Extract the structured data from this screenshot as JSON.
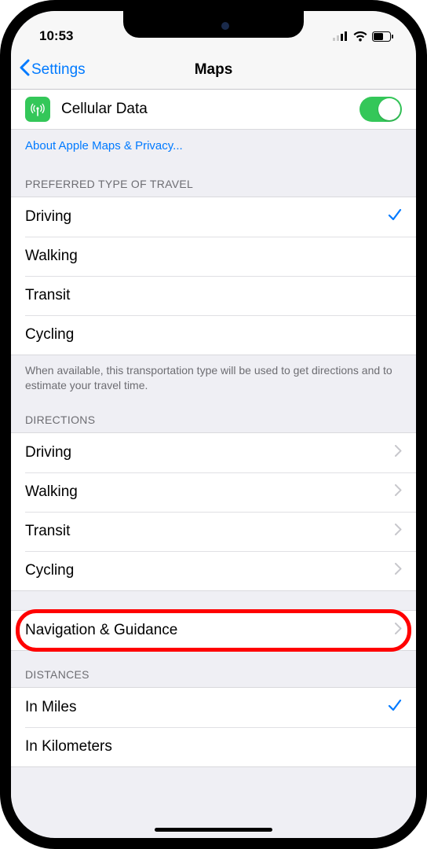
{
  "status": {
    "time": "10:53"
  },
  "nav": {
    "back": "Settings",
    "title": "Maps"
  },
  "cellular": {
    "label": "Cellular Data",
    "on": true
  },
  "privacy_link": "About Apple Maps & Privacy...",
  "preferred": {
    "header": "PREFERRED TYPE OF TRAVEL",
    "items": [
      "Driving",
      "Walking",
      "Transit",
      "Cycling"
    ],
    "selected_index": 0,
    "footer": "When available, this transportation type will be used to get directions and to estimate your travel time."
  },
  "directions": {
    "header": "DIRECTIONS",
    "items": [
      "Driving",
      "Walking",
      "Transit",
      "Cycling"
    ]
  },
  "nav_guidance": {
    "label": "Navigation & Guidance"
  },
  "distances": {
    "header": "DISTANCES",
    "items": [
      "In Miles",
      "In Kilometers"
    ],
    "selected_index": 0
  },
  "highlight_target": "navigation-guidance"
}
